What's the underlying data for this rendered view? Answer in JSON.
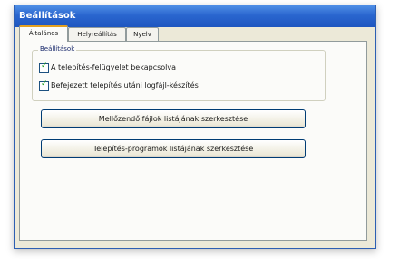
{
  "window": {
    "title": "Beállítások"
  },
  "tabs": [
    {
      "label": "Általános",
      "active": true
    },
    {
      "label": "Helyreállítás",
      "active": false
    },
    {
      "label": "Nyelv",
      "active": false
    }
  ],
  "group": {
    "title": "Beállítások",
    "checkboxes": [
      {
        "label": "A telepítés-felügyelet bekapcsolva",
        "checked": true
      },
      {
        "label": "Befejezett telepítés utáni logfájl-készítés",
        "checked": true
      }
    ]
  },
  "buttons": {
    "ignore_list": "Mellőzendő fájlok listájának szerkesztése",
    "setup_list": "Telepítés-programok listájának szerkesztése"
  },
  "colors": {
    "titlebar": "#2a66cf",
    "active_tab_accent": "#e3a020",
    "checkmark": "#21a121"
  }
}
